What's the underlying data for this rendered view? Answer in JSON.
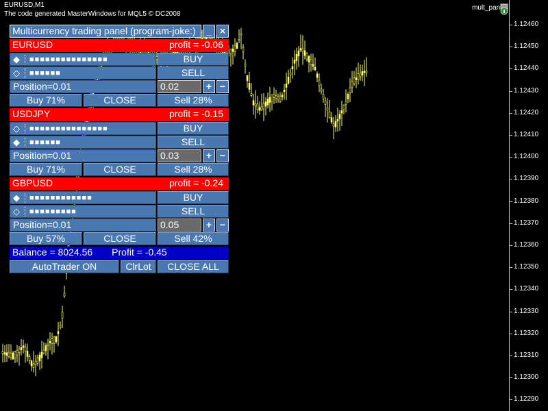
{
  "chart_header": {
    "symbol": "EURUSD,M1",
    "credit": "The code generated MasterWindows for MQL5 © DC2008",
    "indicator_name": "mult_panel"
  },
  "price_axis": [
    "1.12460",
    "1.12450",
    "1.12440",
    "1.12430",
    "1.12420",
    "1.12410",
    "1.12400",
    "1.12390",
    "1.12380",
    "1.12370",
    "1.12360",
    "1.12350",
    "1.12340",
    "1.12330",
    "1.12320",
    "1.12310",
    "1.12300",
    "1.12290"
  ],
  "panel": {
    "title": "Multicurrency trading panel (program-joke:)",
    "minimize_label": "_",
    "close_label": "×",
    "sections": [
      {
        "symbol": "EURUSD",
        "profit": "profit = -0.06",
        "buy_marker": "◆",
        "buy_dots": "■■■■■■■■■■■■■■■",
        "buy_label": "BUY",
        "sell_marker": "◇",
        "sell_dots": "■■■■■■",
        "sell_label": "SELL",
        "position": "Position=0.01",
        "lot": "0.02",
        "plus": "+",
        "minus": "−",
        "buy_pct": "Buy 71%",
        "close_label": "CLOSE",
        "sell_pct": "Sell 28%"
      },
      {
        "symbol": "USDJPY",
        "profit": "profit = -0.15",
        "buy_marker": "◇",
        "buy_dots": "■■■■■■■■■■■■■■■",
        "buy_label": "BUY",
        "sell_marker": "◆",
        "sell_dots": "■■■■■■",
        "sell_label": "SELL",
        "position": "Position=0.01",
        "lot": "0.03",
        "plus": "+",
        "minus": "−",
        "buy_pct": "Buy 71%",
        "close_label": "CLOSE",
        "sell_pct": "Sell 28%"
      },
      {
        "symbol": "GBPUSD",
        "profit": "profit = -0.24",
        "buy_marker": "◆",
        "buy_dots": "■■■■■■■■■■■■",
        "buy_label": "BUY",
        "sell_marker": "◇",
        "sell_dots": "■■■■■■■■■",
        "sell_label": "SELL",
        "position": "Position=0.01",
        "lot": "0.05",
        "plus": "+",
        "minus": "−",
        "buy_pct": "Buy 57%",
        "close_label": "CLOSE",
        "sell_pct": "Sell 42%"
      }
    ],
    "balance": "Balance = 8024.56",
    "total_profit": "Profit = -0.45",
    "autotrader_label": "AutoTrader ON",
    "clrlot_label": "ClrLot",
    "close_all_label": "CLOSE ALL"
  },
  "colors": {
    "candle": "#ffff66",
    "panel_button": "#4a78b0",
    "header_red": "#ff0000",
    "balance_blue": "#0000c8"
  },
  "icons": [
    "mult-panel-indicator-icon"
  ]
}
